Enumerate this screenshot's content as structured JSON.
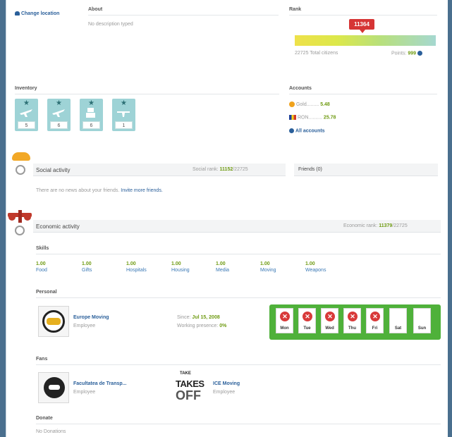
{
  "location": {
    "label": "Change location"
  },
  "about": {
    "title": "About",
    "text": "No description typed"
  },
  "rank": {
    "title": "Rank",
    "value": "11364",
    "citizens": "22725 Total citizens",
    "points_label": "Points:",
    "points_value": "999"
  },
  "inventory": {
    "title": "Inventory",
    "items": [
      {
        "icon": "plane-icon",
        "count": "5"
      },
      {
        "icon": "plane-icon",
        "count": "6"
      },
      {
        "icon": "plane-icon",
        "count": "6"
      },
      {
        "icon": "plane-icon",
        "count": "1"
      }
    ]
  },
  "accounts": {
    "title": "Accounts",
    "gold_label": "Gold.........",
    "gold_value": "5.48",
    "currency_label": "RON..........",
    "currency_value": "25.78",
    "all_link": "All accounts"
  },
  "social": {
    "title": "Social activity",
    "rank_label": "Social rank:",
    "rank_value": "11152",
    "rank_total": "/22725",
    "friends": "Friends (0)",
    "news_text": "There are no news about your friends.",
    "invite_link": "Invite more friends."
  },
  "economic": {
    "title": "Economic activity",
    "rank_label": "Economic rank:",
    "rank_value": "11379",
    "rank_total": "/22725"
  },
  "skills": {
    "title": "Skills",
    "items": [
      {
        "value": "1.00",
        "name": "Food"
      },
      {
        "value": "1.00",
        "name": "Gifts"
      },
      {
        "value": "1.00",
        "name": "Hospitals"
      },
      {
        "value": "1.00",
        "name": "Housing"
      },
      {
        "value": "1.00",
        "name": "Media"
      },
      {
        "value": "1.00",
        "name": "Moving"
      },
      {
        "value": "1.00",
        "name": "Weapons"
      }
    ]
  },
  "personal": {
    "title": "Personal",
    "company": "Europe Moving",
    "role": "Employee",
    "since_label": "Since:",
    "since_value": "Jul 15, 2008",
    "working_label": "Working presence",
    "working_value": "0%",
    "days": [
      "Mon",
      "Tue",
      "Wed",
      "Thu",
      "Fri",
      "Sat",
      "Sun"
    ],
    "worked": [
      true,
      true,
      true,
      true,
      true,
      false,
      false
    ]
  },
  "fans": {
    "title": "Fans",
    "org1_name": "Facultatea de Transp...",
    "org1_role": "Employee",
    "org2_logo_small": "TAKE",
    "org2_logo_mid": "TAKES",
    "org2_logo_big": "OFF",
    "org2_name": "ICE Moving",
    "org2_role": "Employee"
  },
  "donate": {
    "title": "Donate",
    "text": "No Donations"
  }
}
